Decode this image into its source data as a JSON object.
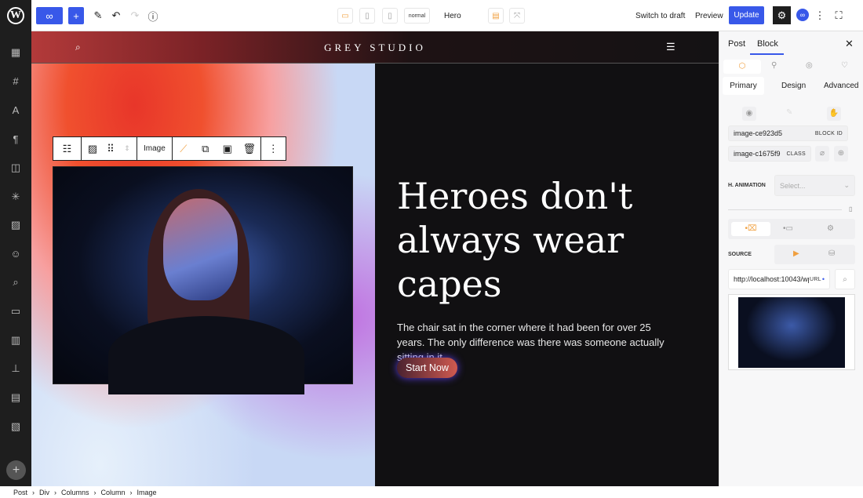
{
  "topbar": {
    "device_label": "normal",
    "template": "Hero",
    "switch_draft": "Switch to draft",
    "preview": "Preview",
    "update": "Update"
  },
  "canvas": {
    "brand": "GREY STUDIO",
    "heading": "Heroes don't always wear capes",
    "paragraph": "The chair sat in the corner where it had been for over 25 years. The only difference was there was someone actually sitting in it.",
    "cta": "Start Now"
  },
  "block_toolbar": {
    "type_label": "Image"
  },
  "panel": {
    "tabs": [
      "Post",
      "Block"
    ],
    "subtabs": [
      "Primary",
      "Design",
      "Advanced"
    ],
    "block_id": "image-ce923d5",
    "block_id_label": "BLOCK ID",
    "class_value": "image-c1675f9",
    "class_label": "CLASS",
    "animation_label": "H. ANIMATION",
    "animation_placeholder": "Select...",
    "source_label": "SOURCE",
    "url_value": "http://localhost:10043/wp",
    "url_label": "URL"
  },
  "colors": {
    "accent": "#3858e9",
    "active_icon": "#f0a040"
  },
  "breadcrumb": [
    "Post",
    "Div",
    "Columns",
    "Column",
    "Image"
  ]
}
